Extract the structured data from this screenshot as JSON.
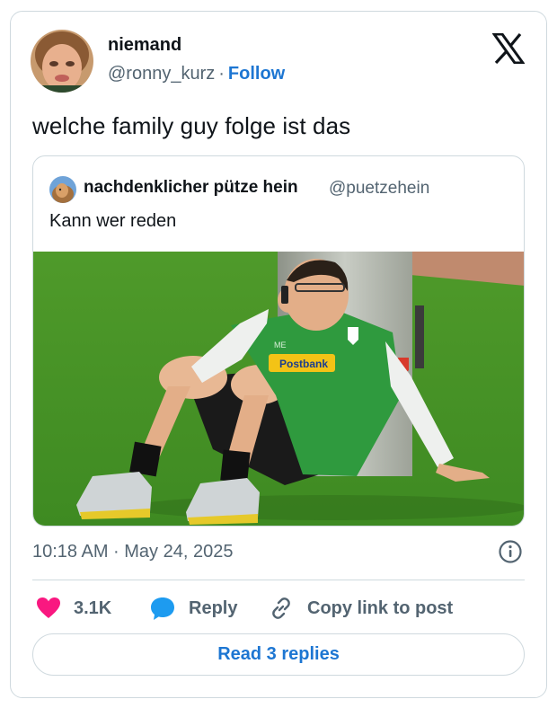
{
  "author": {
    "name": "niemand",
    "handle": "@ronny_kurz",
    "separator": "·",
    "follow_label": "Follow"
  },
  "tweet": {
    "text": "welche family guy folge ist das",
    "timestamp": "10:18 AM · May 24, 2025"
  },
  "quoted": {
    "name": "nachdenklicher pütze hein",
    "handle": "@puetzehein",
    "text": "Kann wer reden",
    "photo_jersey_sponsor": "Postbank",
    "photo_jersey_initials": "ME"
  },
  "actions": {
    "like_count": "3.1K",
    "reply_label": "Reply",
    "copy_label": "Copy link to post"
  },
  "footer": {
    "read_replies_label": "Read 3 replies"
  },
  "colors": {
    "accent": "#1d76d2",
    "like": "#f91880",
    "reply_icon": "#1d9bf0",
    "muted": "#536471",
    "border": "#cfd9de"
  },
  "icons": [
    "x-logo-icon",
    "info-icon",
    "heart-icon",
    "reply-bubble-icon",
    "link-icon"
  ]
}
